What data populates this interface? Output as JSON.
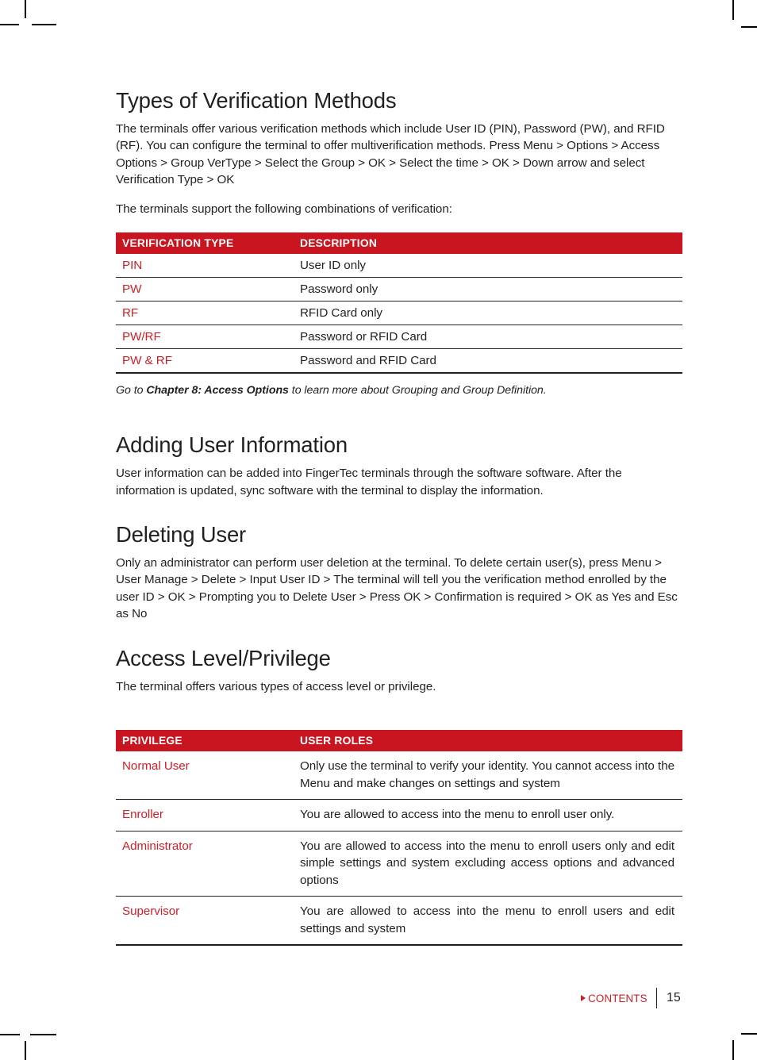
{
  "page": {
    "number": "15",
    "contents_link": "CONTENTS",
    "contents_arrow_icon": "triangle-right-icon",
    "accent_red": "#c8151f",
    "text_red": "#cc2029",
    "text_dark": "#231f20"
  },
  "sections": [
    {
      "id": "verification-methods",
      "title": "Types of Verification Methods",
      "paragraphs": [
        "The terminals offer various verification methods which include User ID (PIN), Password (PW), and RFID (RF).  You can configure the terminal to offer multiverification methods. Press Menu > Options > Access Options > Group VerType > Select the Group > OK > Select the time > OK > Down arrow and select Verification Type > OK",
        "The terminals support the following combinations of verification:"
      ],
      "note": {
        "lead": "Go to ",
        "bold": "Chapter 8: Access Options",
        "tail": " to learn more about Grouping and Group Definition."
      }
    },
    {
      "id": "adding-user-information",
      "title": "Adding User Information",
      "paragraphs": [
        "User information can be added into FingerTec terminals through the software software. After the information is updated, sync software with the terminal to display the information."
      ]
    },
    {
      "id": "deleting-user",
      "title": "Deleting User",
      "paragraphs": [
        "Only an administrator can perform user deletion at the terminal. To delete certain user(s), press Menu > User Manage > Delete > Input User ID > The terminal will tell you the verification method enrolled by the user ID > OK > Prompting you to Delete User > Press OK > Confirmation is required > OK as Yes and Esc as No"
      ]
    },
    {
      "id": "access-level-privilege",
      "title": "Access Level/Privilege",
      "paragraphs": [
        "The terminal offers various types of access level or privilege."
      ]
    }
  ],
  "table_verification": {
    "headers": [
      "VERIFICATION TYPE",
      "DESCRIPTION"
    ],
    "rows": [
      {
        "key": "PIN",
        "value": "User ID only"
      },
      {
        "key": "PW",
        "value": "Password only"
      },
      {
        "key": "RF",
        "value": "RFID Card only"
      },
      {
        "key": "PW/RF",
        "value": "Password or RFID Card"
      },
      {
        "key": "PW & RF",
        "value": "Password and RFID Card"
      }
    ]
  },
  "table_privilege": {
    "headers": [
      "PRIVILEGE",
      "USER ROLES"
    ],
    "rows": [
      {
        "key": "Normal User",
        "value": "Only use the terminal to verify your identity. You cannot access into the Menu and make changes on settings and system"
      },
      {
        "key": "Enroller",
        "value": "You are allowed to access into the menu to enroll user only."
      },
      {
        "key": "Administrator",
        "value": "You are allowed to access into the menu to enroll users only and edit simple settings and system excluding access options and advanced options"
      },
      {
        "key": "Supervisor",
        "value": "You are allowed to access into the menu to enroll users and edit settings and system"
      }
    ]
  }
}
